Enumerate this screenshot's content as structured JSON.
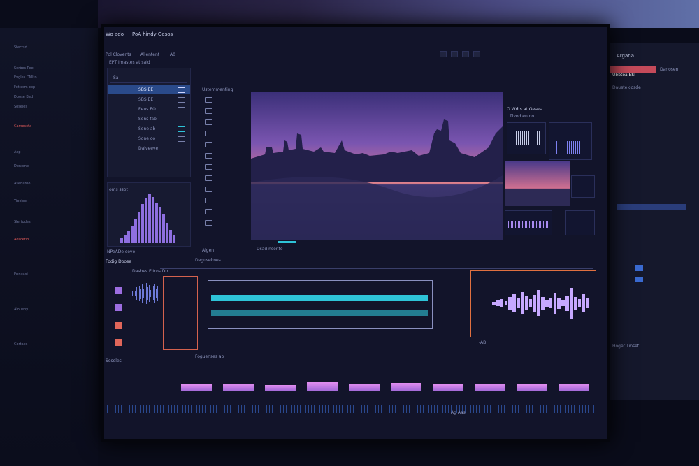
{
  "app": {
    "title": "Wo ado",
    "project": "PoA hindy Gesos"
  },
  "toolbar": {
    "tab1": "Pol Clovents",
    "tab2": "Allentent",
    "tab3": "A0"
  },
  "media_panel": {
    "header": "EPT Imastes at said",
    "rows": [
      {
        "name": "Sa",
        "value": "",
        "selected": false
      },
      {
        "name": "",
        "value": "SBS EE",
        "selected": true
      },
      {
        "name": "",
        "value": "SBS EE",
        "selected": false
      },
      {
        "name": "",
        "value": "Eeus EO",
        "selected": false
      },
      {
        "name": "",
        "value": "Sons fab",
        "selected": false
      },
      {
        "name": "",
        "value": "Sone ab",
        "selected": false
      },
      {
        "name": "",
        "value": "Sone oo",
        "selected": false
      },
      {
        "name": "",
        "value": "Dalveeve",
        "selected": false
      }
    ],
    "histogram_title": "oms ssot",
    "histogram": [
      8,
      12,
      18,
      26,
      35,
      46,
      58,
      66,
      72,
      68,
      60,
      52,
      42,
      30,
      20,
      12
    ],
    "footer": "NPeADe  ceye"
  },
  "viewer": {
    "header": "Ustemmenting",
    "label": "Algen",
    "controls": "Dsad nsonto",
    "overlay_title": "O Wdts at Geses",
    "overlay_sub": "Tlvod en oo"
  },
  "right_panel": {
    "title": "Argana",
    "tag": "Ubbtea  ESI",
    "item": "Danosen",
    "label": "Dauste cosde",
    "section": "Hoger Tinset"
  },
  "timeline": {
    "header": "Fodig Doose",
    "sub": "Dasbes Eitros Dtr",
    "label": "Deguseknes",
    "waveform_left": [
      4,
      6,
      3,
      8,
      5,
      10,
      7,
      12,
      6,
      9,
      14,
      8,
      11,
      5,
      7,
      9,
      13,
      6,
      10,
      4
    ],
    "waveform_right": [
      3,
      5,
      8,
      4,
      12,
      18,
      9,
      22,
      14,
      8,
      16,
      26,
      12,
      7,
      10,
      20,
      11,
      6,
      15,
      30,
      12,
      8,
      18,
      10
    ],
    "timecode": "-AB",
    "footer": "Foguenses ab"
  },
  "lower_track": {
    "header": "Sesoles",
    "clip_heights": [
      60,
      70,
      55,
      80,
      65,
      75,
      60,
      70,
      58,
      68
    ],
    "footer": "Ag  Aas"
  },
  "left_monitor": {
    "items": [
      "Stecrsd",
      "Serbes Peel",
      "Evgles DMIto",
      "Fotlesm cop",
      "Dbose Bad",
      "Soseles",
      "Cameseta",
      "Aep",
      "Doneme",
      "Asebaroo",
      "Tioeloo",
      "Slertodes",
      "Aoscetio",
      "Eunuasi",
      "Aloueny",
      "Cortaes"
    ]
  },
  "colors": {
    "accent": "#8e6fe0",
    "cyan": "#2ec3d8",
    "red": "#e0665a",
    "bg": "#12142a"
  }
}
